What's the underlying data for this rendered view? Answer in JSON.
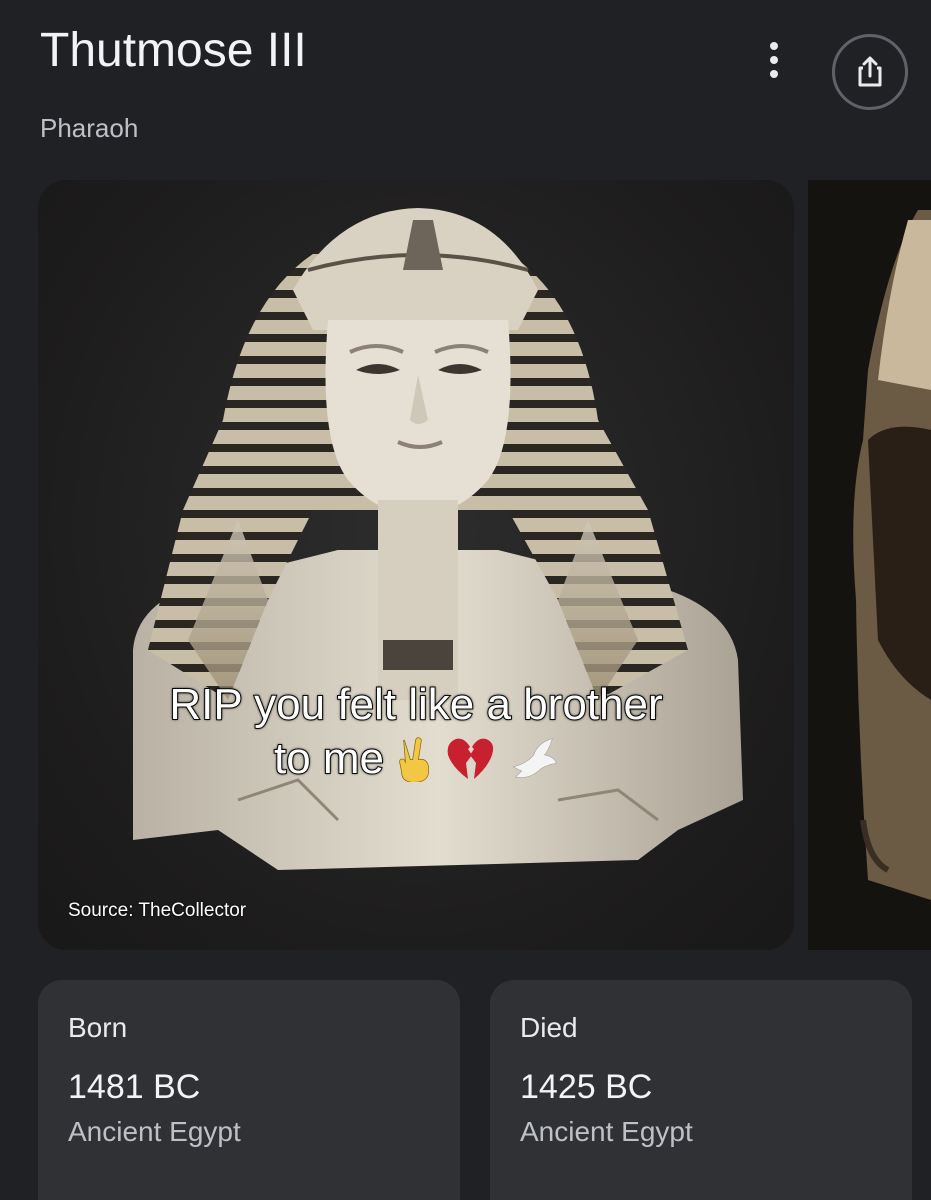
{
  "header": {
    "title": "Thutmose III",
    "subtitle": "Pharaoh",
    "more_icon": "more-vert-icon",
    "share_icon": "share-icon"
  },
  "carousel": {
    "image_alt_subject": "statue-bust",
    "caption_line1": "RIP you felt like a brother",
    "caption_line2": "to me",
    "caption_emojis": [
      "victory-hand",
      "broken-heart",
      "dove"
    ],
    "source": "Source: TheCollector"
  },
  "facts": [
    {
      "label": "Born",
      "value": "1481 BC",
      "place": "Ancient Egypt"
    },
    {
      "label": "Died",
      "value": "1425 BC",
      "place": "Ancient Egypt"
    }
  ],
  "colors": {
    "background": "#202124",
    "card": "#303134",
    "text_primary": "#f1f3f4",
    "text_secondary": "#bdc1c6"
  }
}
